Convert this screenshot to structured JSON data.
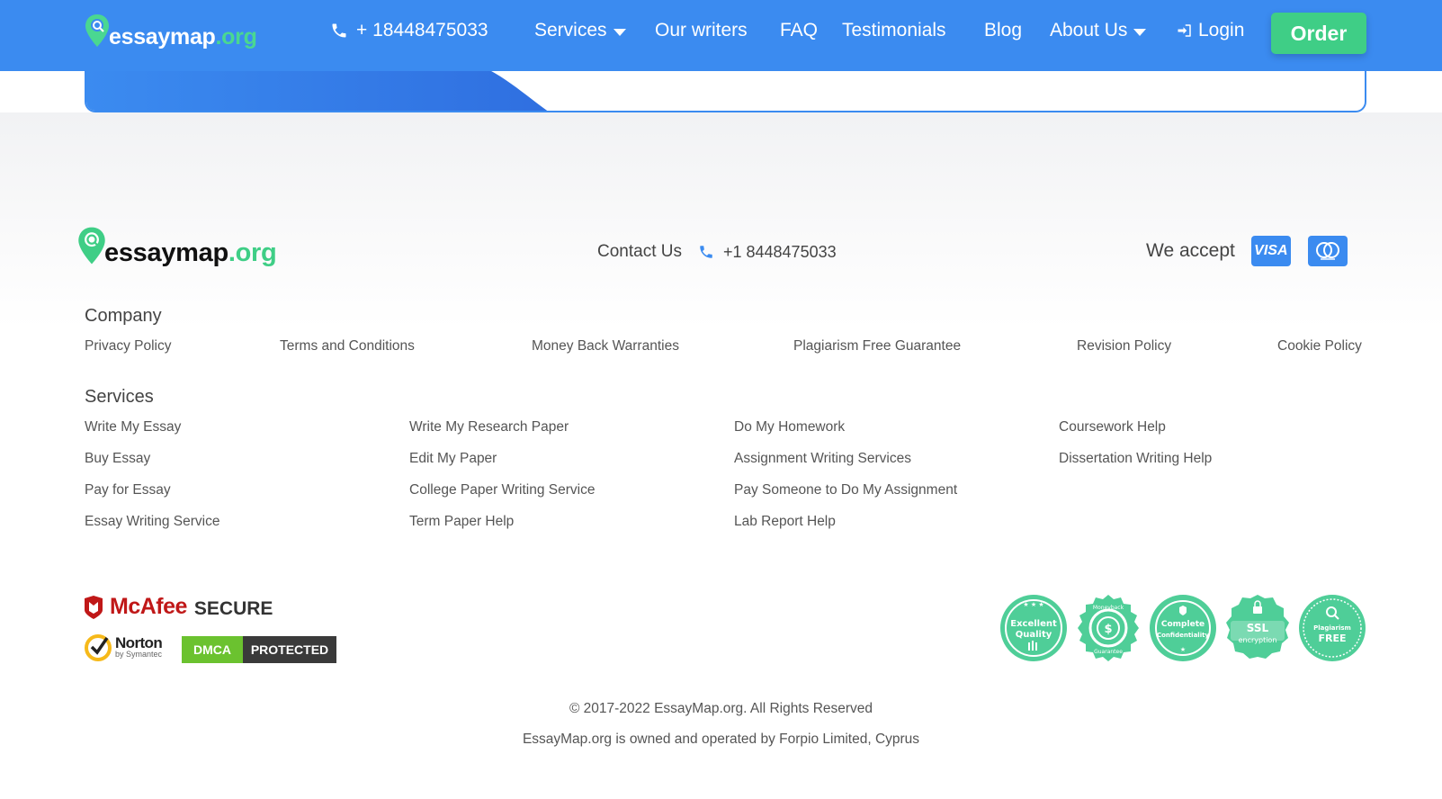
{
  "header": {
    "logo_main": "essaymap",
    "logo_tld": ".org",
    "phone": "+ 18448475033",
    "nav": {
      "services": "Services",
      "writers": "Our writers",
      "faq": "FAQ",
      "testimonials": "Testimonials",
      "blog": "Blog",
      "about": "About Us",
      "login": "Login"
    },
    "order": "Order"
  },
  "footer": {
    "logo_main": "essaymap",
    "logo_tld": ".org",
    "contact_label": "Contact Us",
    "contact_phone": "+1 8448475033",
    "accept_label": "We accept",
    "cards": {
      "visa": "VISA",
      "mastercard_icon": "mastercard-icon"
    },
    "company": {
      "title": "Company",
      "links": [
        "Privacy Policy",
        "Terms and Conditions",
        "Money Back Warranties",
        "Plagiarism Free Guarantee",
        "Revision Policy",
        "Cookie Policy"
      ]
    },
    "services": {
      "title": "Services",
      "columns": [
        [
          "Write My Essay",
          "Buy Essay",
          "Pay for Essay",
          "Essay Writing Service"
        ],
        [
          "Write My Research Paper",
          "Edit My Paper",
          "College Paper Writing Service",
          "Term Paper Help"
        ],
        [
          "Do My Homework",
          "Assignment Writing Services",
          "Pay Someone to Do My Assignment",
          "Lab Report Help"
        ],
        [
          "Coursework Help",
          "Dissertation Writing Help"
        ]
      ]
    },
    "trust": {
      "mcafee": "McAfee",
      "mcafee_secure": "SECURE",
      "norton": "Norton",
      "norton_sub": "by Symantec",
      "dmca_a": "DMCA",
      "dmca_b": "PROTECTED"
    },
    "badges": [
      {
        "line1": "Excellent",
        "line2": "Quality"
      },
      {
        "line1": "Moneyback",
        "line2": "Guarantee"
      },
      {
        "line1": "Complete",
        "line2": "Confidentiality"
      },
      {
        "line1": "SSL",
        "line2": "encryption"
      },
      {
        "line1": "Plagiarism",
        "line2": "FREE"
      }
    ],
    "copyright": "© 2017-2022 EssayMap.org. All Rights Reserved",
    "owner": "EssayMap.org is owned and operated by Forpio Limited, Cyprus"
  },
  "colors": {
    "primary_blue": "#3b8bf0",
    "accent_green": "#3fce86",
    "badge_green": "#4fce98"
  }
}
